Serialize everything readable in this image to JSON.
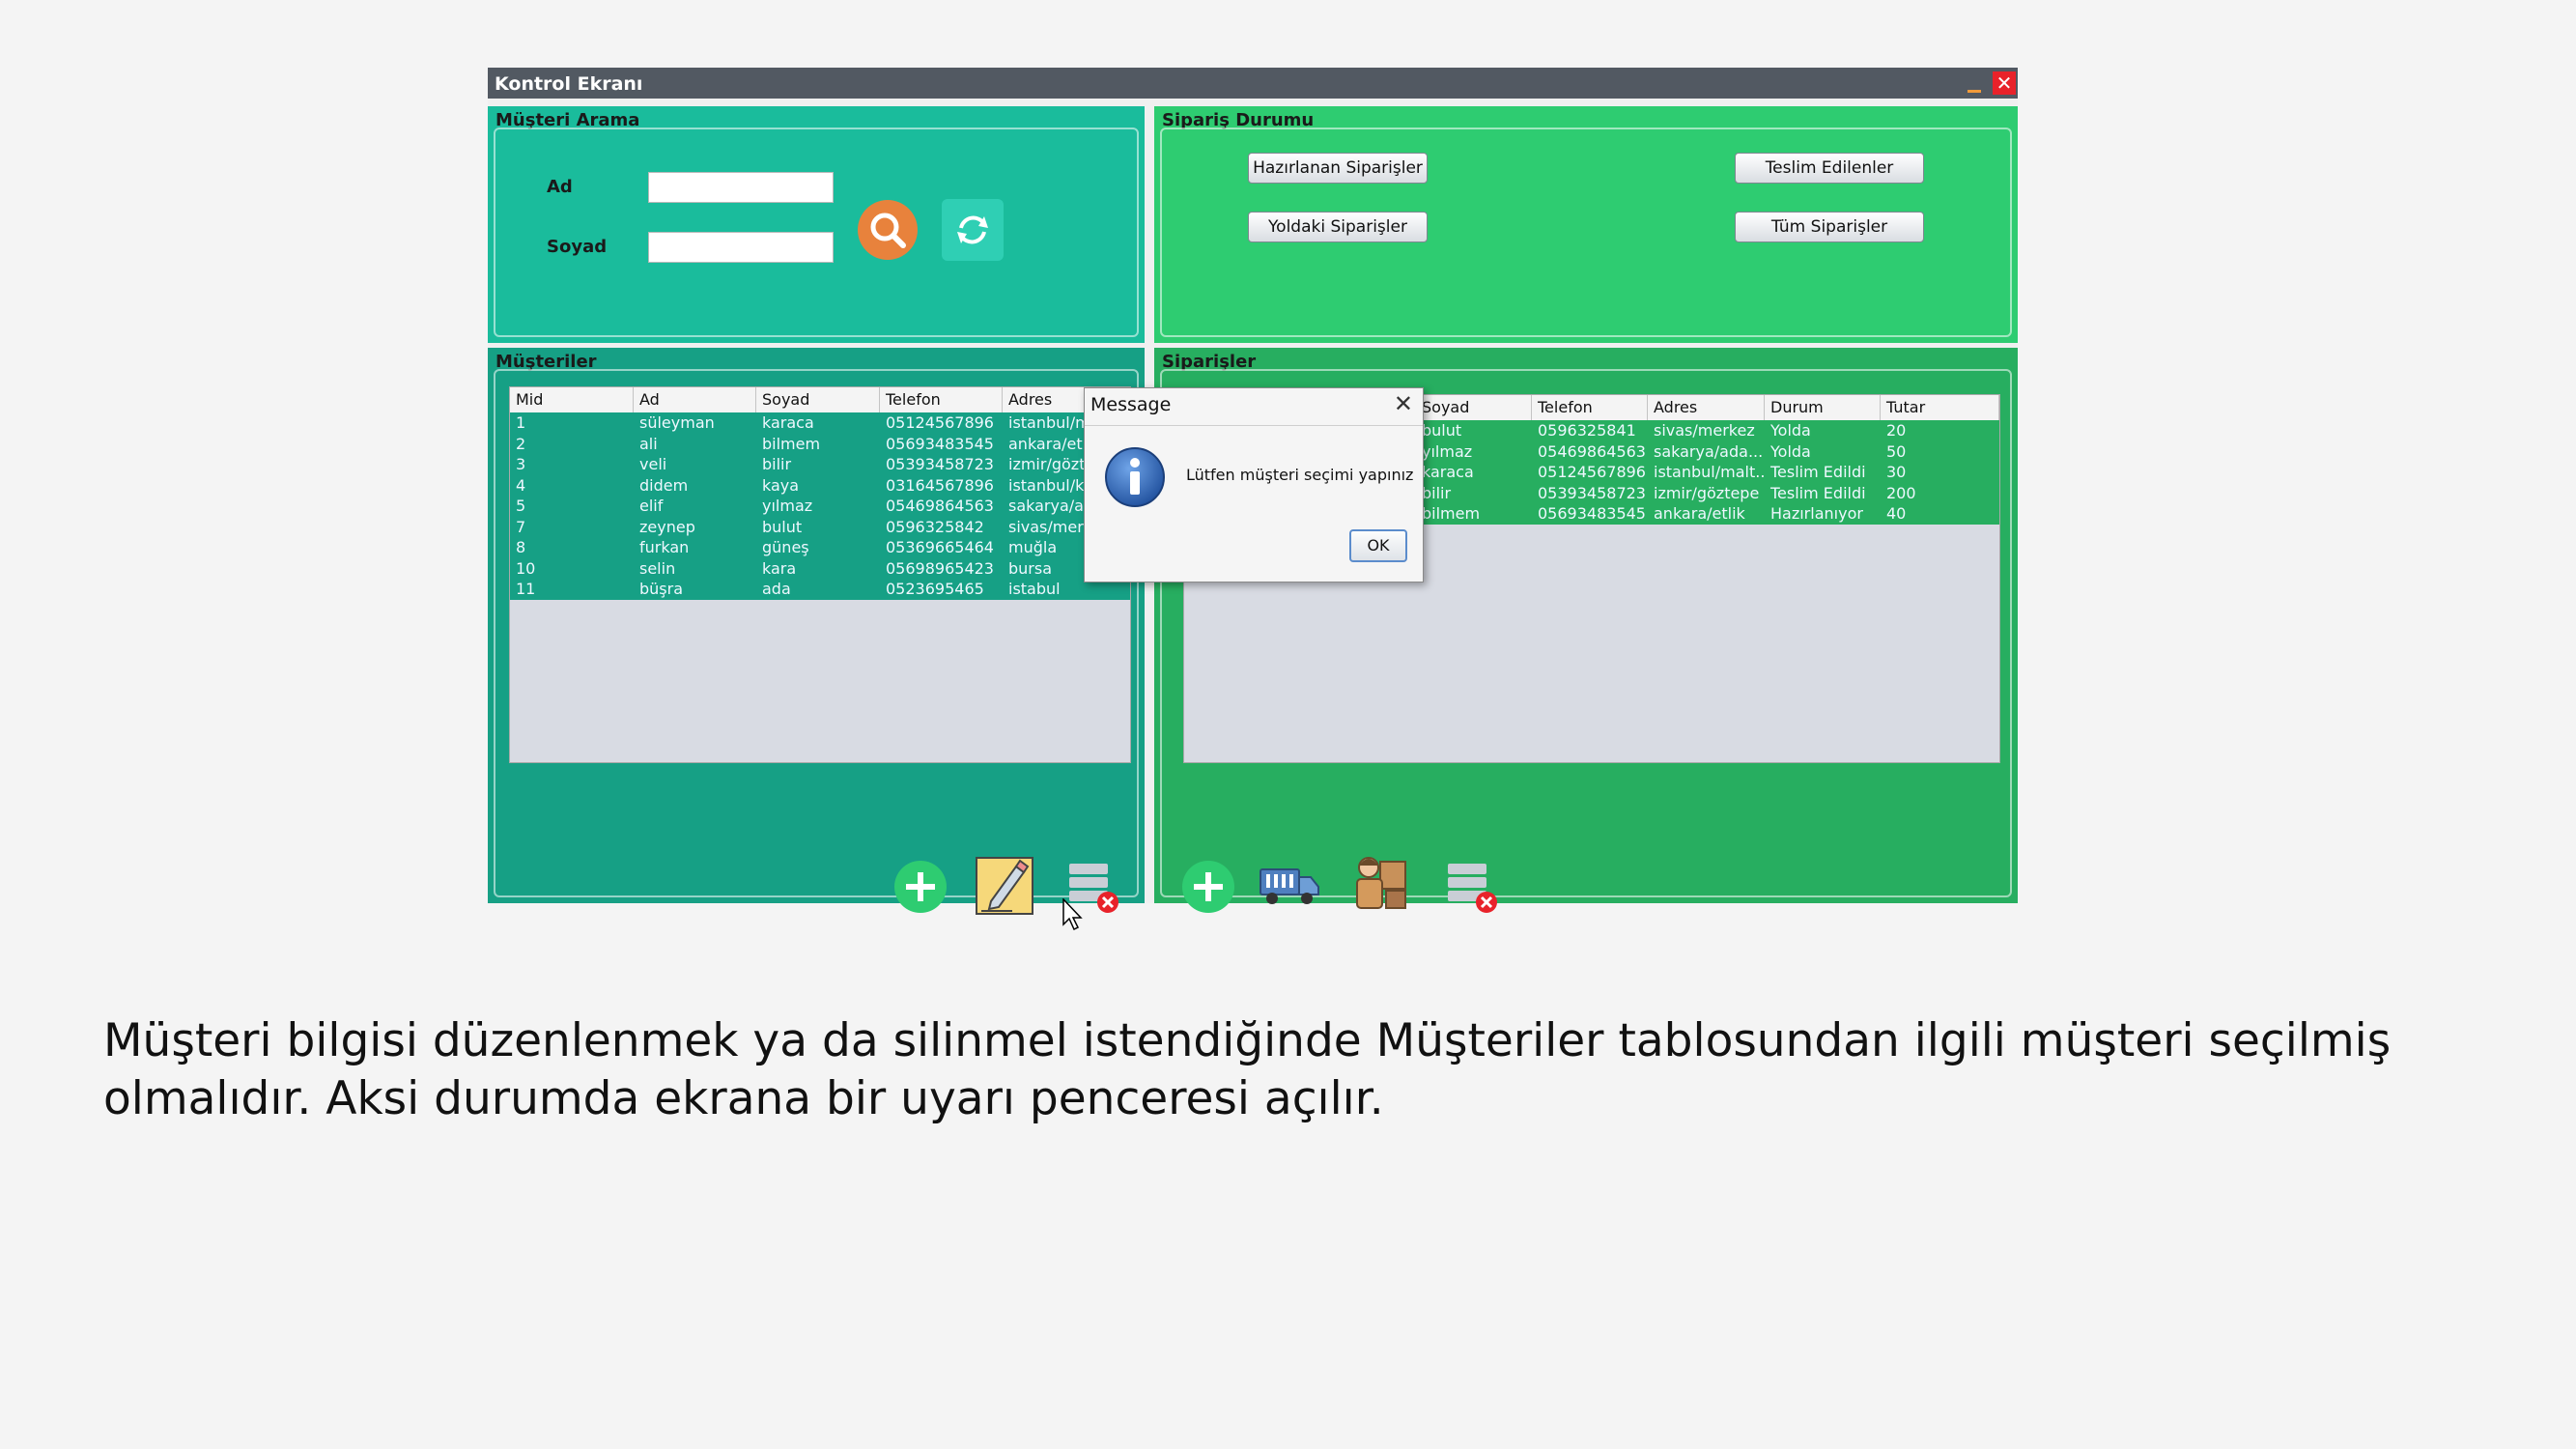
{
  "window": {
    "title": "Kontrol Ekranı",
    "close_glyph": "✕"
  },
  "search_panel": {
    "title": "Müşteri Arama",
    "name_label": "Ad",
    "surname_label": "Soyad",
    "name_value": "",
    "surname_value": ""
  },
  "order_status_panel": {
    "title": "Sipariş Durumu",
    "buttons": [
      "Hazırlanan Siparişler",
      "Teslim Edilenler",
      "Yoldaki Siparişler",
      "Tüm Siparişler"
    ]
  },
  "customers_panel": {
    "title": "Müşteriler",
    "columns": [
      "Mid",
      "Ad",
      "Soyad",
      "Telefon",
      "Adres"
    ],
    "rows": [
      [
        "1",
        "süleyman",
        "karaca",
        "05124567896",
        "istanbul/m"
      ],
      [
        "2",
        "ali",
        "bilmem",
        "05693483545",
        "ankara/etli"
      ],
      [
        "3",
        "veli",
        "bilir",
        "05393458723",
        "izmir/gözte"
      ],
      [
        "4",
        "didem",
        "kaya",
        "03164567896",
        "istanbul/ka"
      ],
      [
        "5",
        "elif",
        "yılmaz",
        "05469864563",
        "sakarya/ad"
      ],
      [
        "7",
        "zeynep",
        "bulut",
        "0596325842",
        "sivas/merk"
      ],
      [
        "8",
        "furkan",
        "güneş",
        "05369665464",
        "muğla"
      ],
      [
        "10",
        "selin",
        "kara",
        "05698965423",
        "bursa"
      ],
      [
        "11",
        "büşra",
        "ada",
        "0523695465",
        "istabul"
      ]
    ]
  },
  "orders_panel": {
    "title": "Siparişler",
    "columns": [
      "Soyad",
      "Telefon",
      "Adres",
      "Durum",
      "Tutar"
    ],
    "rows": [
      [
        "bulut",
        "0596325841",
        "sivas/merkez",
        "Yolda",
        "20"
      ],
      [
        "yılmaz",
        "05469864563",
        "sakarya/ada...",
        "Yolda",
        "50"
      ],
      [
        "karaca",
        "05124567896",
        "istanbul/malt...",
        "Teslim Edildi",
        "30"
      ],
      [
        "bilir",
        "05393458723",
        "izmir/göztepe",
        "Teslim Edildi",
        "200"
      ],
      [
        "bilmem",
        "05693483545",
        "ankara/etlik",
        "Hazırlanıyor",
        "40"
      ]
    ]
  },
  "dialog": {
    "title": "Message",
    "close_glyph": "✕",
    "message": "Lütfen müşteri seçimi yapınız",
    "ok_label": "OK",
    "icon": "info-icon"
  },
  "caption": "Müşteri bilgisi düzenlenmek ya da silinmel istendiğinde Müşteriler tablosundan ilgili müşteri seçilmiş olmalıdır. Aksi durumda ekrana bir uyarı penceresi açılır.",
  "colors": {
    "customer_panel_bg": "#1abc9c",
    "order_panel_bg": "#2ecc71",
    "customer_lower_bg": "#16a085",
    "order_lower_bg": "#27ae60",
    "titlebar": "#525962"
  }
}
